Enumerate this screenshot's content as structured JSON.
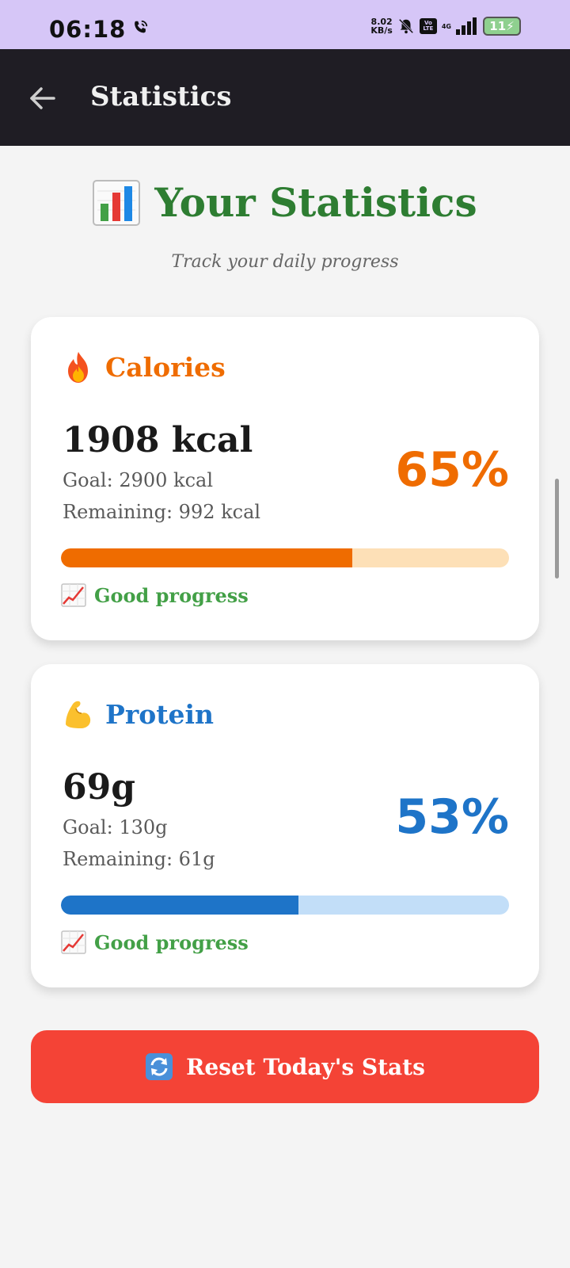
{
  "status_bar": {
    "time": "06:18",
    "speed_value": "8.02",
    "speed_unit": "KB/s",
    "volte": "Vo LTE",
    "network": "4G",
    "battery": "11"
  },
  "app_bar": {
    "title": "Statistics"
  },
  "header": {
    "title": "Your Statistics",
    "subtitle": "Track your daily progress"
  },
  "cards": [
    {
      "title": "Calories",
      "value": "1908 kcal",
      "goal": "Goal: 2900 kcal",
      "remaining": "Remaining: 992 kcal",
      "percent": "65%",
      "progress": 0.65,
      "note": "Good progress"
    },
    {
      "title": "Protein",
      "value": "69g",
      "goal": "Goal: 130g",
      "remaining": "Remaining: 61g",
      "percent": "53%",
      "progress": 0.53,
      "note": "Good progress"
    }
  ],
  "reset": {
    "label": "Reset Today's Stats"
  },
  "colors": {
    "title_green": "#2e7d32",
    "calories_orange": "#ef6c00",
    "protein_blue": "#1e74c8",
    "reset_red": "#f44336",
    "note_green": "#43a047"
  },
  "icons": {
    "calories": "fire-icon",
    "protein": "flexed-biceps-icon",
    "header": "bar-chart-icon",
    "note": "chart-increasing-icon",
    "reset": "refresh-icon"
  }
}
